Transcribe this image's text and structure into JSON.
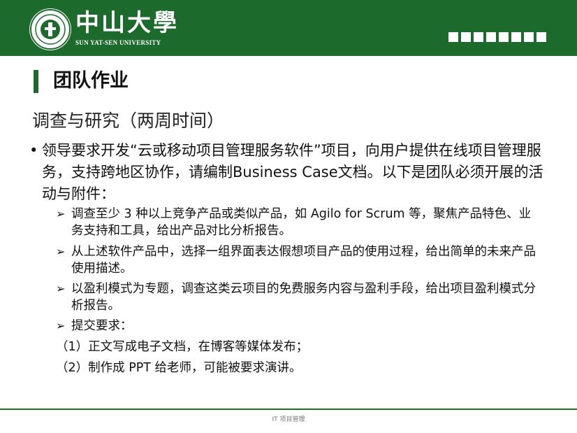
{
  "header": {
    "logo_name": "中山大學",
    "logo_sub": "SUN YAT-SEN UNIVERSITY",
    "seal_icon": "university-seal-icon",
    "square_count": 8,
    "brand_color": "#1d6a2d"
  },
  "slide": {
    "title": "团队作业",
    "subtitle": "调查与研究（两周时间）",
    "main_bullet": "领导要求开发“云或移动项目管理服务软件”项目，向用户提供在线项目管理服务，支持跨地区协作，请编制Business Case文档。以下是团队必须开展的活动与附件：",
    "sub_items": [
      "调查至少 3 种以上竞争产品或类似产品，如 Agilo for Scrum 等，聚焦产品特色、业务支持和工具，给出产品对比分析报告。",
      "从上述软件产品中，选择一组界面表达假想项目产品的使用过程，给出简单的未来产品使用描述。",
      "以盈利模式为专题，调查这类云项目的免费服务内容与盈利手段，给出项目盈利模式分析报告。",
      "提交要求："
    ],
    "requirements": [
      "（1）正文写成电子文档，在博客等媒体发布；",
      "（2）制作成 PPT 给老师，可能被要求演讲。"
    ]
  },
  "footer": {
    "text": "IT 项目管理"
  }
}
